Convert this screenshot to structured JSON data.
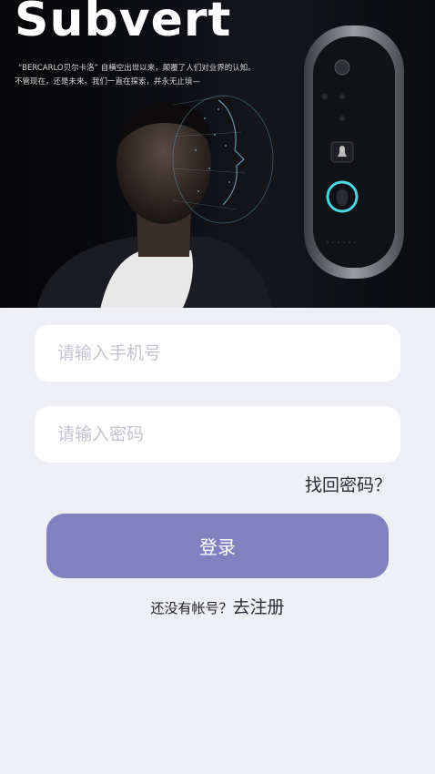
{
  "banner": {
    "brand": "Subvert",
    "tagline_line1": "“BERCARLO贝尔卡洛” 自横空出世以来，颠覆了人们对业界的认知。",
    "tagline_line2": "不管现在，还是未来。我们一直在探索，并永无止境—"
  },
  "form": {
    "phone_placeholder": "请输入手机号",
    "password_placeholder": "请输入密码",
    "forgot_label": "找回密码？",
    "login_label": "登录",
    "no_account_text": "还没有帐号？",
    "register_label": "去注册"
  },
  "colors": {
    "background": "#eef0f5",
    "button": "#8380bf",
    "banner": "#0c0d12"
  }
}
